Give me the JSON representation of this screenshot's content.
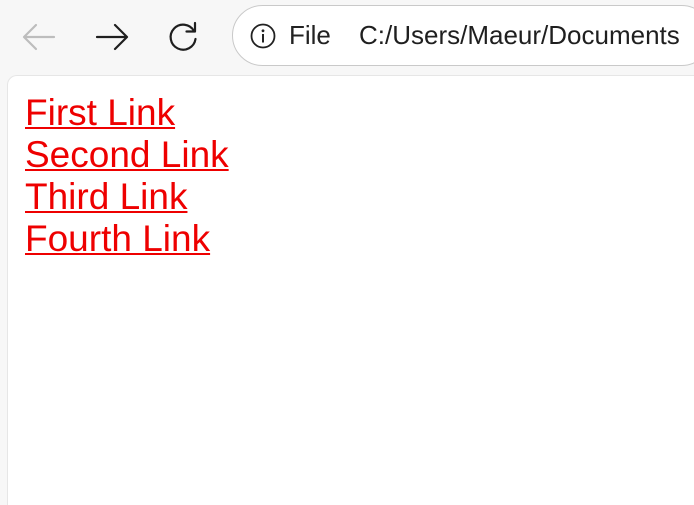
{
  "browser": {
    "nav": {
      "back_icon": "arrow-left-icon",
      "forward_icon": "arrow-right-icon",
      "reload_icon": "reload-icon"
    },
    "address_bar": {
      "info_icon": "info-icon",
      "scheme_label": "File",
      "url": "C:/Users/Maeur/Documents"
    }
  },
  "page": {
    "links": [
      {
        "label": "First Link"
      },
      {
        "label": "Second Link"
      },
      {
        "label": "Third Link"
      },
      {
        "label": "Fourth Link"
      }
    ]
  },
  "colors": {
    "link": "#ee0000",
    "background": "#ffffff",
    "toolbar": "#f7f7f7"
  }
}
